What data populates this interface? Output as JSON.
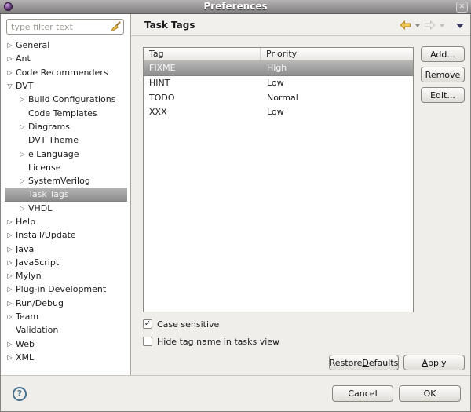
{
  "window": {
    "title": "Preferences",
    "close_glyph": "✕"
  },
  "sidebar": {
    "filter_placeholder": "type filter text",
    "items": [
      {
        "label": "General",
        "depth": 0,
        "state": "collapsed",
        "selected": false
      },
      {
        "label": "Ant",
        "depth": 0,
        "state": "collapsed",
        "selected": false
      },
      {
        "label": "Code Recommenders",
        "depth": 0,
        "state": "collapsed",
        "selected": false
      },
      {
        "label": "DVT",
        "depth": 0,
        "state": "expanded",
        "selected": false
      },
      {
        "label": "Build Configurations",
        "depth": 1,
        "state": "collapsed",
        "selected": false
      },
      {
        "label": "Code Templates",
        "depth": 1,
        "state": "leaf",
        "selected": false
      },
      {
        "label": "Diagrams",
        "depth": 1,
        "state": "collapsed",
        "selected": false
      },
      {
        "label": "DVT Theme",
        "depth": 1,
        "state": "leaf",
        "selected": false
      },
      {
        "label": "e Language",
        "depth": 1,
        "state": "collapsed",
        "selected": false
      },
      {
        "label": "License",
        "depth": 1,
        "state": "leaf",
        "selected": false
      },
      {
        "label": "SystemVerilog",
        "depth": 1,
        "state": "collapsed",
        "selected": false
      },
      {
        "label": "Task Tags",
        "depth": 1,
        "state": "leaf",
        "selected": true
      },
      {
        "label": "VHDL",
        "depth": 1,
        "state": "collapsed",
        "selected": false
      },
      {
        "label": "Help",
        "depth": 0,
        "state": "collapsed",
        "selected": false
      },
      {
        "label": "Install/Update",
        "depth": 0,
        "state": "collapsed",
        "selected": false
      },
      {
        "label": "Java",
        "depth": 0,
        "state": "collapsed",
        "selected": false
      },
      {
        "label": "JavaScript",
        "depth": 0,
        "state": "collapsed",
        "selected": false
      },
      {
        "label": "Mylyn",
        "depth": 0,
        "state": "collapsed",
        "selected": false
      },
      {
        "label": "Plug-in Development",
        "depth": 0,
        "state": "collapsed",
        "selected": false
      },
      {
        "label": "Run/Debug",
        "depth": 0,
        "state": "collapsed",
        "selected": false
      },
      {
        "label": "Team",
        "depth": 0,
        "state": "collapsed",
        "selected": false
      },
      {
        "label": "Validation",
        "depth": 0,
        "state": "leaf",
        "selected": false
      },
      {
        "label": "Web",
        "depth": 0,
        "state": "collapsed",
        "selected": false
      },
      {
        "label": "XML",
        "depth": 0,
        "state": "collapsed",
        "selected": false
      }
    ]
  },
  "header": {
    "title": "Task Tags"
  },
  "table": {
    "columns": [
      "Tag",
      "Priority"
    ],
    "rows": [
      {
        "tag": "FIXME",
        "priority": "High",
        "selected": true
      },
      {
        "tag": "HINT",
        "priority": "Low",
        "selected": false
      },
      {
        "tag": "TODO",
        "priority": "Normal",
        "selected": false
      },
      {
        "tag": "XXX",
        "priority": "Low",
        "selected": false
      }
    ]
  },
  "actions": {
    "add": "Add...",
    "remove": "Remove",
    "edit": "Edit..."
  },
  "options": [
    {
      "label": "Case sensitive",
      "checked": true
    },
    {
      "label": "Hide tag name in tasks view",
      "checked": false
    }
  ],
  "panel_footer": {
    "restore_defaults": {
      "label": "Restore Defaults",
      "mnemonic": "D"
    },
    "apply": {
      "label": "Apply",
      "mnemonic": "A"
    }
  },
  "dialog_buttons": {
    "cancel": "Cancel",
    "ok": "OK"
  },
  "icons": {
    "help": "?",
    "check": "✓",
    "collapsed_arrow": "▷",
    "expanded_arrow": "▽"
  },
  "colors": {
    "selection_top": "#b7b7b7",
    "selection_bottom": "#8e8e8e",
    "titlebar_top": "#b5b3b3",
    "titlebar_bottom": "#7f7d7d",
    "back_arrow_gold": "#f0c860",
    "menu_triangle_navy": "#3a3a5e",
    "help_blue": "#46718f",
    "eclipse_purple": "#6a3b82"
  }
}
